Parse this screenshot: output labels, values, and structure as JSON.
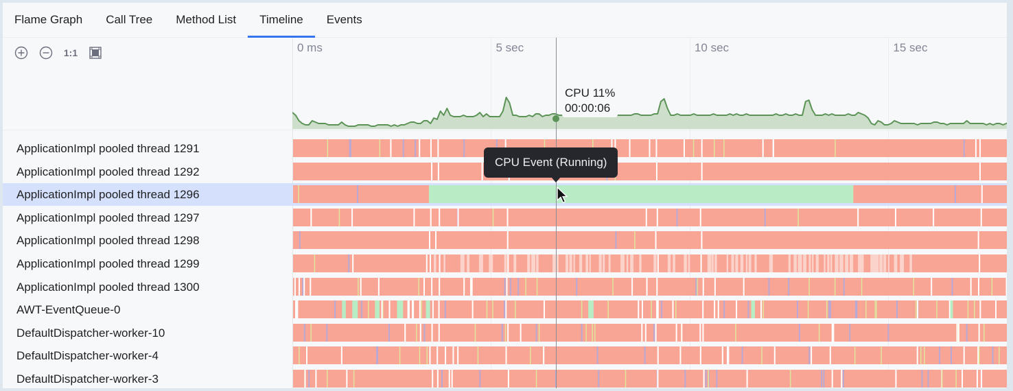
{
  "tabs": [
    {
      "label": "Flame Graph",
      "active": false
    },
    {
      "label": "Call Tree",
      "active": false
    },
    {
      "label": "Method List",
      "active": false
    },
    {
      "label": "Timeline",
      "active": true
    },
    {
      "label": "Events",
      "active": false
    }
  ],
  "toolbar": {
    "zoom_in_icon": "plus-circle-icon",
    "zoom_out_icon": "minus-circle-icon",
    "actual_size_label": "1:1",
    "fit_icon": "fit-frame-icon"
  },
  "timeline": {
    "ticks": [
      {
        "label": "0 ms",
        "seconds": 0
      },
      {
        "label": "5 sec",
        "seconds": 5
      },
      {
        "label": "10 sec",
        "seconds": 10
      },
      {
        "label": "15 sec",
        "seconds": 15
      }
    ],
    "visible_range_seconds": [
      0,
      18.05
    ],
    "cursor_seconds": 6.6,
    "cpu_readout": {
      "line1": "CPU 11%",
      "line2": "00:00:06"
    },
    "tooltip": "CPU Event (Running)",
    "colors": {
      "running": "#b8ecc4",
      "sleeping": "#f9a595",
      "sleeping_light": "#fcd3cb",
      "accent_yellow": "#dfe59a",
      "accent_lavender": "#b7a9d4",
      "cpu_line": "#5b9255",
      "cpu_fill": "#cddfcb",
      "tab_accent": "#3574f0"
    }
  },
  "cpu_series": {
    "unit": "percent",
    "seconds_step": 0.12,
    "values": [
      12,
      10,
      6,
      4,
      3,
      3,
      6,
      5,
      4,
      4,
      4,
      3,
      3,
      3,
      3,
      5,
      3,
      2,
      2,
      2,
      3,
      3,
      3,
      3,
      2,
      2,
      3,
      3,
      3,
      3,
      2,
      3,
      2,
      3,
      3,
      4,
      5,
      5,
      4,
      4,
      6,
      6,
      4,
      8,
      7,
      13,
      10,
      15,
      10,
      9,
      9,
      9,
      10,
      9,
      9,
      9,
      10,
      12,
      9,
      11,
      9,
      9,
      9,
      9,
      13,
      23,
      19,
      10,
      10,
      9,
      9,
      9,
      10,
      9,
      11,
      11,
      9,
      10,
      10,
      11,
      11,
      10,
      10,
      10,
      10,
      10,
      10,
      10,
      10,
      10,
      10,
      10,
      10,
      10,
      10,
      11,
      10,
      10,
      10,
      10,
      10,
      10,
      10,
      10,
      11,
      11,
      10,
      10,
      10,
      10,
      11,
      11,
      20,
      22,
      15,
      10,
      10,
      11,
      10,
      10,
      10,
      10,
      11,
      10,
      10,
      10,
      10,
      10,
      11,
      10,
      10,
      10,
      10,
      11,
      10,
      11,
      10,
      10,
      11,
      10,
      10,
      10,
      10,
      10,
      10,
      10,
      10,
      11,
      10,
      10,
      11,
      10,
      10,
      11,
      10,
      10,
      20,
      21,
      14,
      10,
      10,
      10,
      11,
      10,
      11,
      10,
      10,
      10,
      10,
      11,
      10,
      10,
      12,
      11,
      10,
      8,
      4,
      3,
      6,
      5,
      3,
      3,
      4,
      6,
      5,
      4,
      4,
      4,
      4,
      4,
      3,
      4,
      4,
      4,
      4,
      5,
      5,
      4,
      4,
      3,
      4,
      4,
      4,
      4,
      4,
      6,
      4,
      4,
      4,
      4,
      4,
      3,
      4,
      3,
      4,
      4,
      3,
      4,
      5
    ]
  },
  "threads": [
    {
      "name": "ApplicationImpl pooled thread 1291",
      "selected": false,
      "pattern": "busy-gaps"
    },
    {
      "name": "ApplicationImpl pooled thread 1292",
      "selected": false,
      "pattern": "mostly-solid"
    },
    {
      "name": "ApplicationImpl pooled thread 1296",
      "selected": true,
      "pattern": "running-span",
      "running_from_seconds": 3.42,
      "running_to_seconds": 14.1
    },
    {
      "name": "ApplicationImpl pooled thread 1297",
      "selected": false,
      "pattern": "few-gaps"
    },
    {
      "name": "ApplicationImpl pooled thread 1298",
      "selected": false,
      "pattern": "mostly-solid"
    },
    {
      "name": "ApplicationImpl pooled thread 1299",
      "selected": false,
      "pattern": "striped-middle"
    },
    {
      "name": "ApplicationImpl pooled thread 1300",
      "selected": false,
      "pattern": "noisy"
    },
    {
      "name": "AWT-EventQueue-0",
      "selected": false,
      "pattern": "very-noisy"
    },
    {
      "name": "DefaultDispatcher-worker-10",
      "selected": false,
      "pattern": "noisy"
    },
    {
      "name": "DefaultDispatcher-worker-4",
      "selected": false,
      "pattern": "noisy"
    },
    {
      "name": "DefaultDispatcher-worker-3",
      "selected": false,
      "pattern": "noisy"
    }
  ]
}
